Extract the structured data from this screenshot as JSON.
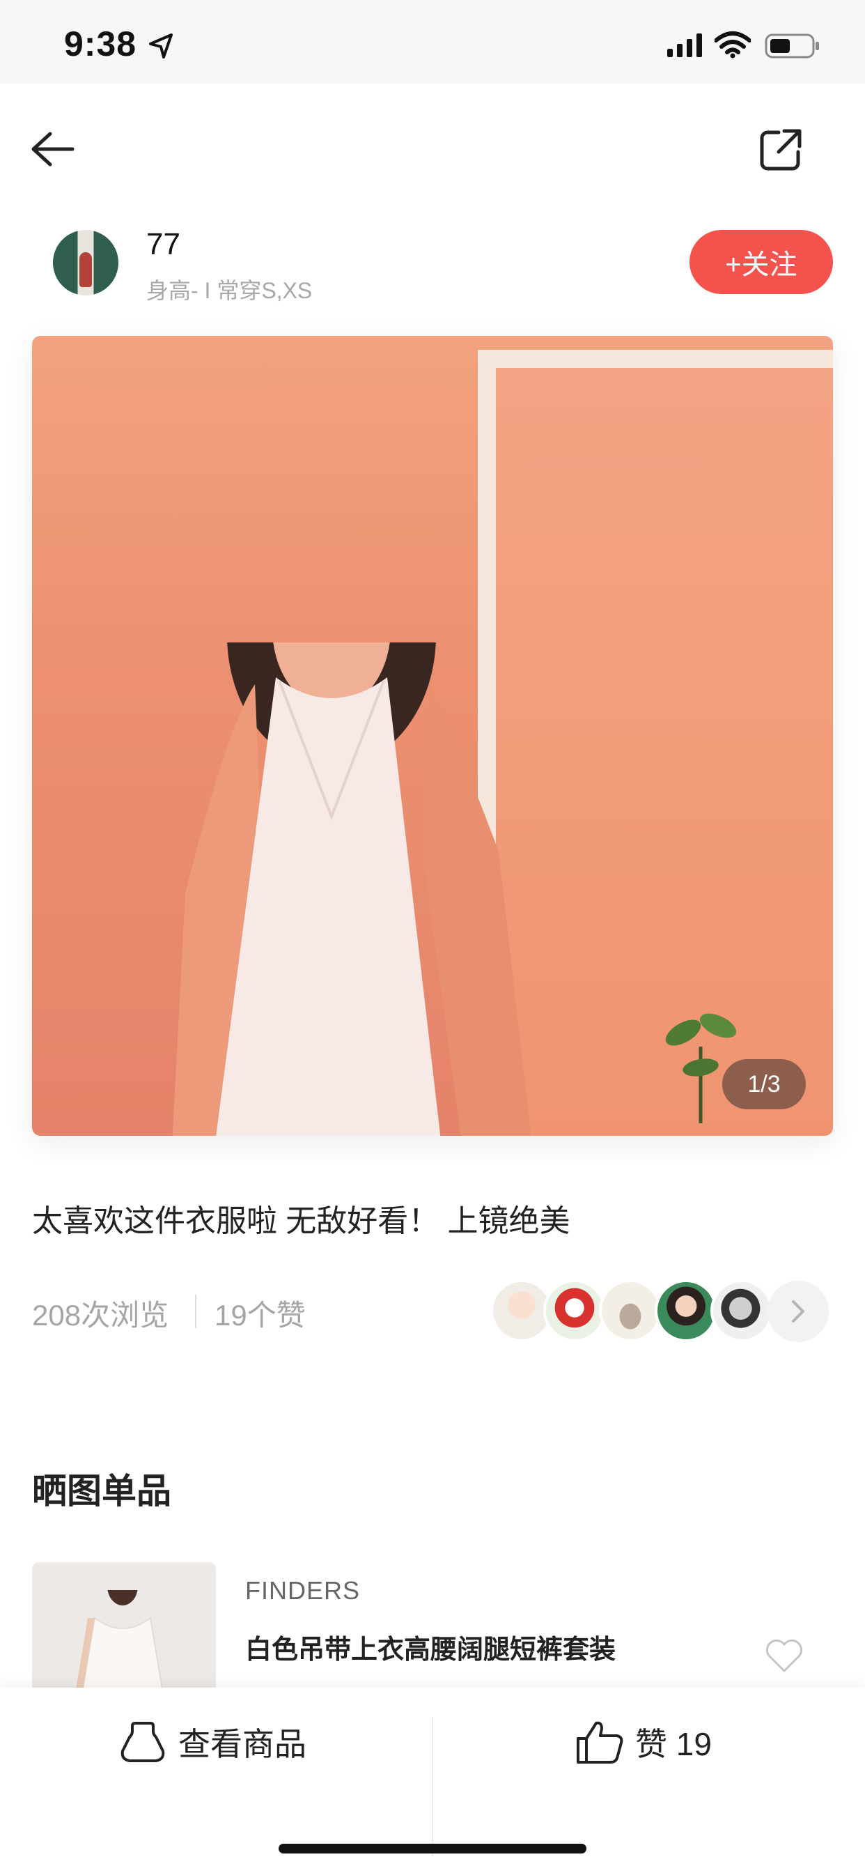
{
  "status_bar": {
    "time": "9:38",
    "icons": [
      "location-arrow-icon",
      "signal-icon",
      "wifi-icon",
      "battery-icon"
    ]
  },
  "nav": {
    "back_icon": "arrow-left-icon",
    "share_icon": "share-external-icon"
  },
  "user": {
    "name": "77",
    "meta": "身高- I 常穿S,XS",
    "follow_label": "+关注",
    "accent_color": "#f4524d"
  },
  "post": {
    "image_indicator": "1/3",
    "caption": "太喜欢这件衣服啦 无敌好看！ 上镜绝美",
    "views": "208次浏览",
    "likes": "19个赞",
    "liker_count_shown": 5
  },
  "products": {
    "section_title": "晒图单品",
    "items": [
      {
        "brand": "FINDERS",
        "title": "白色吊带上衣高腰阔腿短裤套装"
      }
    ]
  },
  "bottom_bar": {
    "view_goods_label": "查看商品",
    "like_label": "赞 19"
  }
}
